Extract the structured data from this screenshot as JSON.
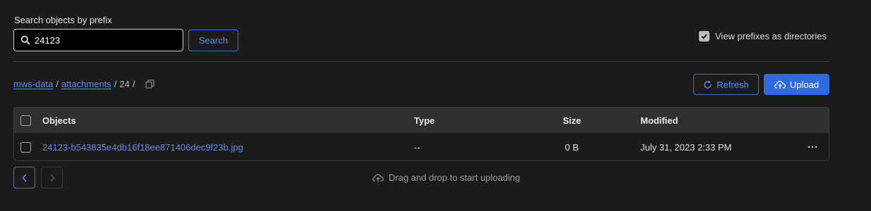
{
  "search": {
    "label": "Search objects by prefix",
    "value": "24123",
    "button_label": "Search"
  },
  "view_prefixes": {
    "label": "View prefixes as directories",
    "checked": true
  },
  "breadcrumb": {
    "items": [
      "mws-data",
      "attachments",
      "24"
    ],
    "separator": "/"
  },
  "toolbar": {
    "refresh_label": "Refresh",
    "upload_label": "Upload"
  },
  "table": {
    "columns": [
      "Objects",
      "Type",
      "Size",
      "Modified"
    ],
    "rows": [
      {
        "name": "24123-b543835e4db16f18ee871406dec9f23b.jpg",
        "type": "--",
        "size": "0 B",
        "modified": "July 31, 2023 2:33 PM"
      }
    ]
  },
  "drop_hint": "Drag and drop to start uploading",
  "colors": {
    "background": "#1b1b1c",
    "accent": "#2f6ae0",
    "link": "#5a8df0"
  },
  "icons": [
    "search-icon",
    "checkbox-checked-icon",
    "copy-icon",
    "refresh-icon",
    "cloud-upload-icon",
    "more-horizontal-icon",
    "chevron-left-icon",
    "chevron-right-icon",
    "cloud-icon"
  ]
}
